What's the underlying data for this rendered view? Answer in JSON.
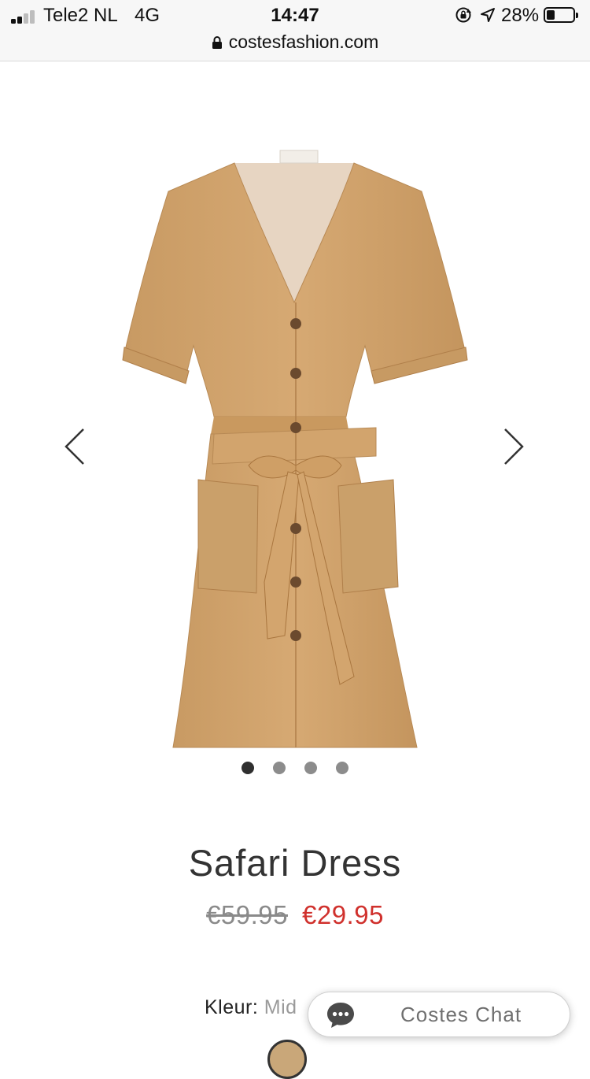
{
  "status_bar": {
    "carrier": "Tele2 NL",
    "network": "4G",
    "time": "14:47",
    "battery_percent": "28%",
    "battery_level": 0.28,
    "signal_bars": 2,
    "icons": [
      "signal-icon",
      "rotation-lock-icon",
      "location-arrow-icon",
      "battery-icon"
    ]
  },
  "browser": {
    "url": "costesfashion.com",
    "secure": true
  },
  "carousel": {
    "image_subject": "dress-image",
    "slide_count": 4,
    "active_slide": 1,
    "prev_icon": "chevron-left-icon",
    "next_icon": "chevron-right-icon"
  },
  "product": {
    "title": "Safari Dress",
    "price_old": "€59.95",
    "price_new": "€29.95",
    "colour_label": "Kleur:",
    "colour_value": "Mid",
    "swatch_color": "#c9a779"
  },
  "chat": {
    "label": "Costes Chat",
    "icon": "chat-bubble-icon"
  },
  "colors": {
    "sale_red": "#d0312d",
    "dress_tan": "#cfa26c",
    "chat_icon": "#4a4a4a"
  }
}
